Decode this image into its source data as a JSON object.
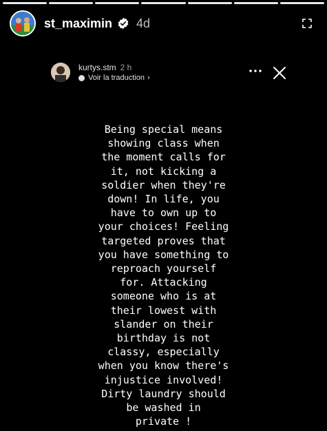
{
  "progress": {
    "segments": 7,
    "completed": 7
  },
  "header": {
    "username": "st_maximin",
    "time_ago": "4d",
    "avatar_icon": "profile-photo",
    "verified_icon": "verified-badge"
  },
  "repost": {
    "username": "kurtys.stm",
    "time_ago": "2 h",
    "translate_label": "Voir la traduction",
    "chevron": "›"
  },
  "story": {
    "text": "Being special means\nshowing class when\nthe moment calls for\nit, not kicking a\nsoldier when they're\ndown! In life, you\nhave to own up to\nyour choices! Feeling\ntargeted proves that\nyou have something to\nreproach yourself\nfor. Attacking\nsomeone who is at\ntheir lowest with\nslander on their\nbirthday is not\nclassy, especially\nwhen you know there's\ninjustice involved!\nDirty laundry should\nbe washed in\nprivate !"
  }
}
